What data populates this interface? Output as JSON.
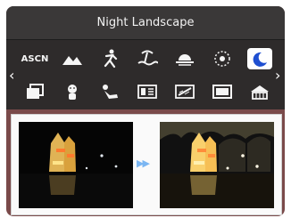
{
  "header": {
    "title": "Night Landscape"
  },
  "scene_modes": {
    "row1": [
      {
        "name": "asn-scene",
        "label": "ASCN"
      },
      {
        "name": "landscape",
        "label": ""
      },
      {
        "name": "sport",
        "label": ""
      },
      {
        "name": "beach",
        "label": ""
      },
      {
        "name": "sunset",
        "label": ""
      },
      {
        "name": "fireworks",
        "label": ""
      },
      {
        "name": "night-landscape",
        "label": "",
        "selected": true
      }
    ],
    "row2": [
      {
        "name": "frame",
        "label": ""
      },
      {
        "name": "kids",
        "label": ""
      },
      {
        "name": "pet",
        "label": ""
      },
      {
        "name": "text",
        "label": ""
      },
      {
        "name": "sketch",
        "label": ""
      },
      {
        "name": "window",
        "label": ""
      },
      {
        "name": "building",
        "label": ""
      }
    ]
  },
  "navigation": {
    "prev": "‹",
    "next": "›"
  },
  "preview": {
    "flow_marker": "▶▶"
  },
  "colors": {
    "accent": "#1f4fd1",
    "panel": "#7a4a4a",
    "header": "#3a3838"
  }
}
